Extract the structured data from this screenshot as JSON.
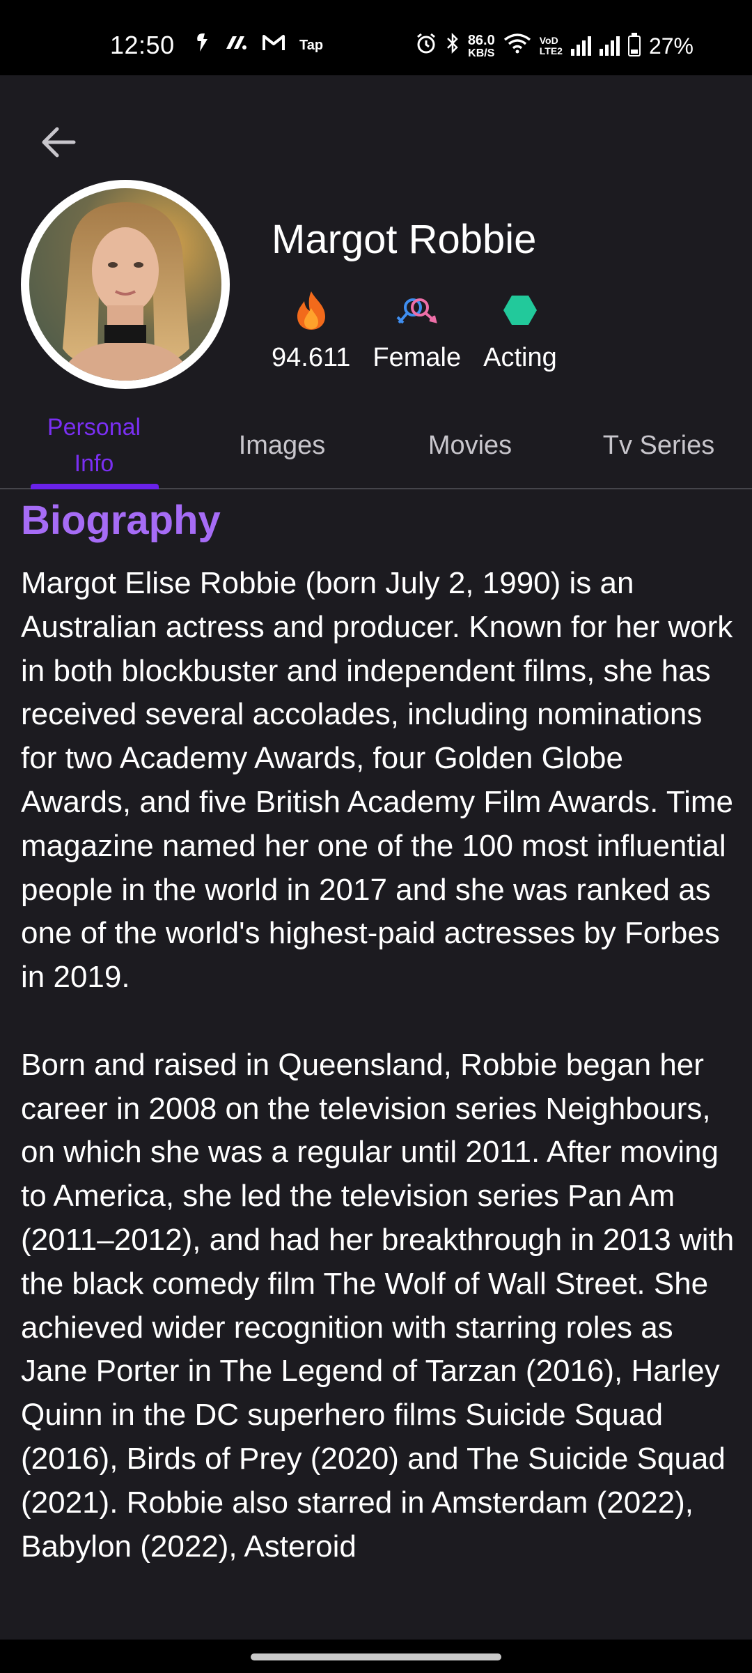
{
  "status_bar": {
    "time": "12:50",
    "tap_label": "Tap",
    "net_speed_value": "86.0",
    "net_speed_unit": "KB/S",
    "volte_top": "VoD",
    "volte_bottom": "LTE2",
    "battery_percent": "27%",
    "icons": [
      "notification-icon",
      "app-icon",
      "gmail-icon",
      "tap-icon",
      "alarm-icon",
      "bluetooth-icon",
      "wifi-icon",
      "signal-icon",
      "battery-icon"
    ]
  },
  "header": {
    "back_icon": "arrow-left-icon"
  },
  "profile": {
    "name": "Margot Robbie",
    "popularity": "94.611",
    "gender": "Female",
    "department": "Acting",
    "icons": {
      "popularity": "fire-icon",
      "gender": "gender-icon",
      "department": "hexagon-icon"
    },
    "colors": {
      "fire": "#f5821f",
      "gender_male": "#3f8ef0",
      "gender_female": "#ee6fa8",
      "department": "#22c99b"
    }
  },
  "tabs": {
    "items": [
      {
        "label_line1": "Personal",
        "label_line2": "Info"
      },
      {
        "label": "Images"
      },
      {
        "label": "Movies"
      },
      {
        "label": "Tv Series"
      }
    ],
    "active_index": 0
  },
  "biography": {
    "heading": "Biography",
    "paragraphs": [
      "Margot Elise Robbie (born July 2, 1990) is an Australian actress and producer. Known for her work in both blockbuster and independent films, she has received several accolades, including nominations for two Academy Awards, four Golden Globe Awards, and five British Academy Film Awards. Time magazine named her one of the 100 most influential people in the world in 2017 and she was ranked as one of the world's highest-paid actresses by Forbes in 2019.",
      "Born and raised in Queensland, Robbie began her career in 2008 on the television series Neighbours, on which she was a regular until 2011. After moving to America, she led the television series Pan Am (2011–2012), and had her breakthrough in 2013 with the black comedy film The Wolf of Wall Street. She achieved wider recognition with starring roles as Jane Porter in The Legend of Tarzan (2016), Harley Quinn in the DC superhero films Suicide Squad (2016), Birds of Prey (2020) and The Suicide Squad (2021). Robbie also starred in Amsterdam (2022), Babylon (2022), Asteroid"
    ]
  },
  "colors": {
    "background": "#1c1b20",
    "accent": "#7a2ff2",
    "heading": "#a66cf6"
  }
}
